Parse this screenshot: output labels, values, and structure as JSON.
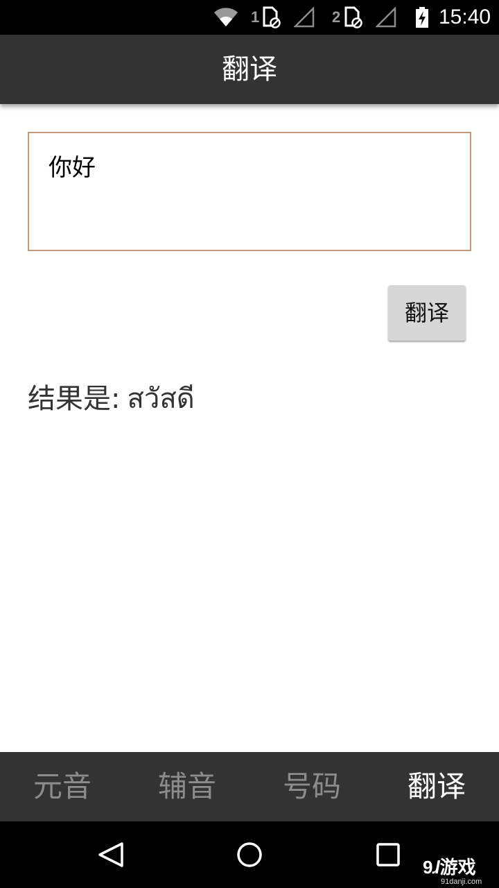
{
  "status_bar": {
    "sim1_label": "1",
    "sim2_label": "2",
    "time": "15:40"
  },
  "app_bar": {
    "title": "翻译"
  },
  "input": {
    "value": "你好"
  },
  "translate_button": {
    "label": "翻译"
  },
  "result": {
    "prefix": "结果是:",
    "value": "สวัสดี"
  },
  "tabs": [
    {
      "label": "元音",
      "active": false
    },
    {
      "label": "辅音",
      "active": false
    },
    {
      "label": "号码",
      "active": false
    },
    {
      "label": "翻译",
      "active": true
    }
  ],
  "watermark": {
    "logo_number": "9",
    "logo_text": "游戏",
    "url": "91danji.com"
  },
  "colors": {
    "app_bar": "#333333",
    "input_border": "#c8977a",
    "button_bg": "#d7d7d7",
    "tab_inactive": "#8c8c8c",
    "tab_active": "#ffffff"
  }
}
